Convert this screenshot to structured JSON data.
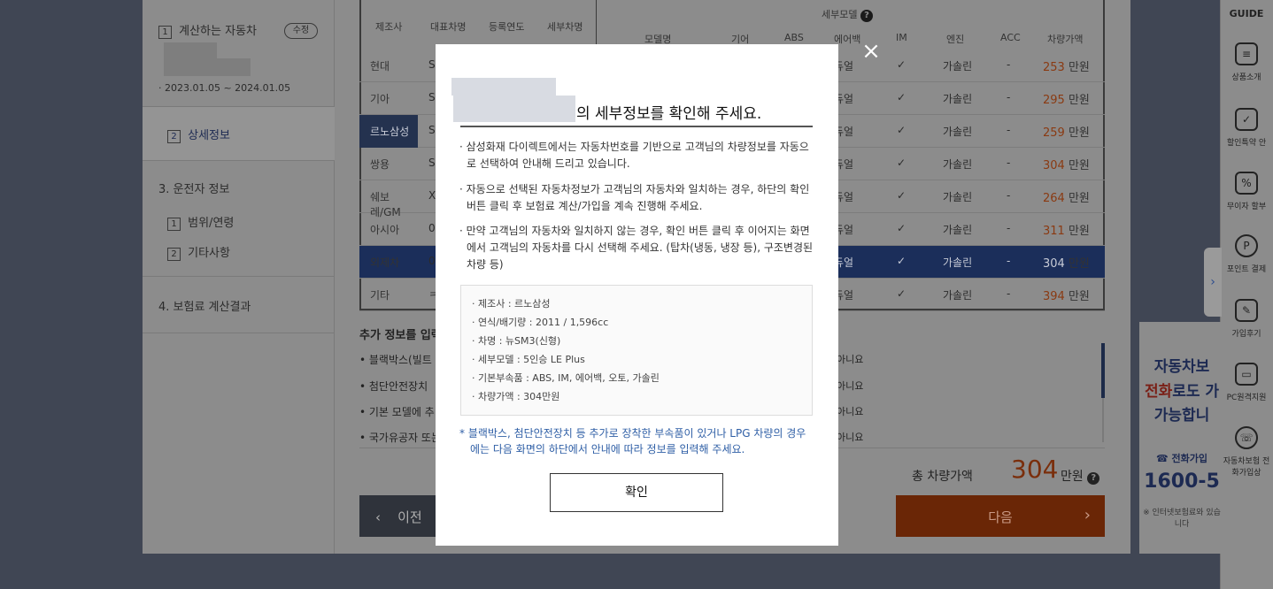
{
  "leftnav": {
    "step1_num": "1",
    "step1_label": "계산하는 자동차",
    "edit_label": "수정",
    "period": "· 2023.01.05 ~ 2024.01.05",
    "step2_num": "2",
    "step2_label": "상세정보",
    "section3": "3. 운전자 정보",
    "s3_item1_num": "1",
    "s3_item1": "범위/연령",
    "s3_item2_num": "2",
    "s3_item2": "기타사항",
    "section4": "4. 보험료 계산결과"
  },
  "table": {
    "headers": {
      "maker": "제조사",
      "model": "대표차명",
      "year": "등록연도",
      "detail_name": "세부차명",
      "detail_model_group": "세부모델",
      "model_name": "모델명",
      "gear": "기어",
      "abs": "ABS",
      "airbag": "에어백",
      "im": "IM",
      "engine": "엔진",
      "acc": "ACC",
      "price": "차량가액"
    },
    "makers": [
      "현대",
      "기아",
      "르노삼성",
      "쌍용",
      "쉐보레/GM",
      "아시아",
      "외제차",
      "기타"
    ],
    "model_initials": [
      "S",
      "S",
      "S",
      "S",
      "X",
      "0",
      "0",
      "ㅋ"
    ],
    "rows": [
      {
        "airbag": "듀얼",
        "im": "✓",
        "engine": "가솔린",
        "acc": "-",
        "price": "253",
        "unit": "만원"
      },
      {
        "airbag": "듀얼",
        "im": "✓",
        "engine": "가솔린",
        "acc": "-",
        "price": "295",
        "unit": "만원"
      },
      {
        "airbag": "듀얼",
        "im": "✓",
        "engine": "가솔린",
        "acc": "-",
        "price": "259",
        "unit": "만원"
      },
      {
        "airbag": "듀얼",
        "im": "✓",
        "engine": "가솔린",
        "acc": "-",
        "price": "304",
        "unit": "만원"
      },
      {
        "airbag": "듀얼",
        "im": "✓",
        "engine": "가솔린",
        "acc": "-",
        "price": "264",
        "unit": "만원"
      },
      {
        "airbag": "듀얼",
        "im": "✓",
        "engine": "가솔린",
        "acc": "-",
        "price": "311",
        "unit": "만원"
      },
      {
        "airbag": "듀얼",
        "im": "✓",
        "engine": "가솔린",
        "acc": "-",
        "price": "304",
        "unit": "만원"
      },
      {
        "airbag": "듀얼",
        "im": "✓",
        "engine": "가솔린",
        "acc": "-",
        "price": "394",
        "unit": "만원"
      }
    ],
    "selected_maker_index": 2,
    "selected_row_index": 6
  },
  "addinfo": {
    "title": "추가 정보를 입력",
    "items": [
      "• 블랙박스(빌트",
      "• 첨단안전장치",
      "• 기본 모델에 추",
      "• 국가유공자 또는"
    ],
    "values": [
      "아니요",
      "아니요",
      "아니요",
      "아니요"
    ]
  },
  "total": {
    "label": "총 차량가액",
    "value": "304",
    "unit": "만원",
    "help": "?"
  },
  "buttons": {
    "prev": "이전",
    "next": "다음"
  },
  "rightside": {
    "guide": "GUIDE",
    "items": [
      "상품소개",
      "할인특약 안",
      "무이자 할부",
      "포인트 결제",
      "가입후기",
      "PC원격지원",
      "자동차보험 전화가입상"
    ]
  },
  "ad": {
    "line1": "자동차보",
    "line2_red": "전화",
    "line2": "로도 가",
    "line3": "가능합니",
    "phone_label": "☎ 전화가입",
    "phone": "1600-5",
    "footnote": "※ 인터넷보험료와 있습니다"
  },
  "modal": {
    "title_suffix": "의 세부정보를 확인해 주세요.",
    "para1": "· 삼성화재 다이렉트에서는 자동차번호를 기반으로 고객님의 차량정보를 자동으로 선택하여 안내해 드리고 있습니다.",
    "para2": "· 자동으로 선택된 자동차정보가 고객님의 자동차와 일치하는 경우, 하단의 확인버튼 클릭 후 보험료 계산/가입을 계속 진행해 주세요.",
    "para3": "· 만약 고객님의 자동차와 일치하지 않는 경우, 확인 버튼 클릭 후 이어지는 화면에서 고객님의 자동차를 다시 선택해 주세요. (탑차(냉동, 냉장 등), 구조변경된 차량 등)",
    "info": [
      "· 제조사 : 르노삼성",
      "· 연식/배기량 : 2011 / 1,596cc",
      "· 차명 : 뉴SM3(신형)",
      "· 세부모델 : 5인승 LE Plus",
      "· 기본부속품 : ABS, IM, 에어백, 오토, 가솔린",
      "· 차량가액 : 304만원"
    ],
    "note": "* 블랙박스, 첨단안전장치 등 추가로 장착한 부속품이 있거나 LPG 차량의 경우에는 다음 화면의 하단에서 안내에 따라 정보를 입력해 주세요.",
    "confirm": "확인",
    "close": "×"
  }
}
